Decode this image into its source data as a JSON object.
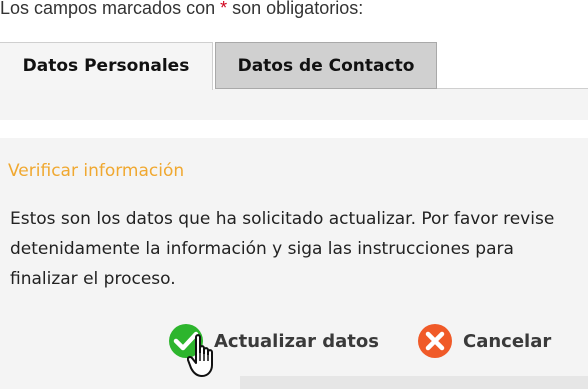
{
  "form": {
    "required_note_prefix": "Los campos marcados con ",
    "required_star": "*",
    "required_note_suffix": " son obligatorios:"
  },
  "tabs": [
    {
      "label": "Datos Personales",
      "active": true
    },
    {
      "label": "Datos de Contacto",
      "active": false
    }
  ],
  "verify": {
    "title": "Verificar información",
    "description": "Estos son los datos que ha solicitado actualizar. Por favor revise detenidamente la información y siga las instrucciones para finalizar el proceso."
  },
  "actions": {
    "update_label": "Actualizar datos",
    "cancel_label": "Cancelar"
  },
  "icons": {
    "update": "check-circle-icon",
    "cancel": "close-circle-icon",
    "cursor": "hand-pointer-icon"
  },
  "colors": {
    "title_accent": "#f0a830",
    "required_star": "#d0021b",
    "check_green": "#2db52d",
    "cancel_red": "#f05a28",
    "inactive_tab": "#d0d0d0"
  }
}
